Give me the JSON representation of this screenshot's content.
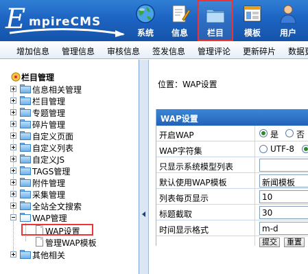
{
  "header": {
    "logo_text": "EmpireCMS",
    "logo_first": "E",
    "logo_rest": "mpireCMS",
    "nav": [
      {
        "label": "系统",
        "icon": "globe-icon"
      },
      {
        "label": "信息",
        "icon": "document-pencil-icon"
      },
      {
        "label": "栏目",
        "icon": "folder-icon",
        "selected": true
      },
      {
        "label": "模板",
        "icon": "window-template-icon"
      },
      {
        "label": "用户",
        "icon": "user-icon"
      }
    ]
  },
  "menubar": {
    "items": [
      "增加信息",
      "管理信息",
      "审核信息",
      "签发信息",
      "管理评论",
      "更新碎片",
      "数据更"
    ]
  },
  "tree": {
    "root": "栏目管理",
    "items": [
      {
        "label": "信息相关管理"
      },
      {
        "label": "栏目管理"
      },
      {
        "label": "专题管理"
      },
      {
        "label": "碎片管理"
      },
      {
        "label": "自定义页面"
      },
      {
        "label": "自定义列表"
      },
      {
        "label": "自定义JS"
      },
      {
        "label": "TAGS管理"
      },
      {
        "label": "附件管理"
      },
      {
        "label": "采集管理"
      },
      {
        "label": "全站全文搜索"
      },
      {
        "label": "WAP管理"
      },
      {
        "label": "WAP设置",
        "selected": true
      },
      {
        "label": "管理WAP模板"
      },
      {
        "label": "其他相关"
      }
    ]
  },
  "main": {
    "breadcrumb_prefix": "位置：",
    "breadcrumb_link": "WAP设置",
    "table_title": "WAP设置",
    "rows": [
      {
        "label": "开启WAP",
        "options": [
          "是",
          "否"
        ],
        "selected": 0
      },
      {
        "label": "WAP字符集",
        "options": [
          "UTF-8",
          ""
        ],
        "selected": 1
      },
      {
        "label": "只显示系统模型列表",
        "value": ""
      },
      {
        "label": "默认使用WAP模板",
        "value": "新闻模板"
      },
      {
        "label": "列表每页显示",
        "value": "10"
      },
      {
        "label": "标题截取",
        "value": "30"
      },
      {
        "label": "时间显示格式",
        "value": "m-d"
      }
    ],
    "submit_label": "提交",
    "reset_label": "重置"
  },
  "colors": {
    "header_blue": "#1d64c2",
    "highlight_red": "#e33",
    "table_header": "#2063b9"
  }
}
